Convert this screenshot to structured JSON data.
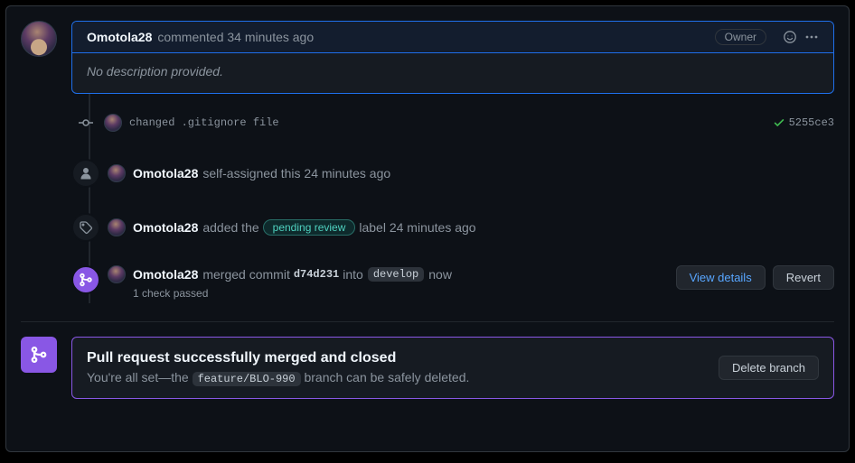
{
  "comment": {
    "author": "Omotola28",
    "action": "commented 34 minutes ago",
    "owner_badge": "Owner",
    "body": "No description provided."
  },
  "timeline": {
    "commit": {
      "message": "changed .gitignore file",
      "sha_short": "5255ce3"
    },
    "self_assign": {
      "author": "Omotola28",
      "text": "self-assigned this 24 minutes ago"
    },
    "label_add": {
      "author": "Omotola28",
      "pre": "added the",
      "label": "pending review",
      "post": "label 24 minutes ago"
    },
    "merge": {
      "author": "Omotola28",
      "pre": "merged commit",
      "sha": "d74d231",
      "mid": "into",
      "branch": "develop",
      "when": "now",
      "checks": "1 check passed",
      "view_details": "View details",
      "revert": "Revert"
    }
  },
  "banner": {
    "title": "Pull request successfully merged and closed",
    "sub_pre": "You're all set—the",
    "branch": "feature/BLO-990",
    "sub_post": "branch can be safely deleted.",
    "delete_btn": "Delete branch"
  }
}
